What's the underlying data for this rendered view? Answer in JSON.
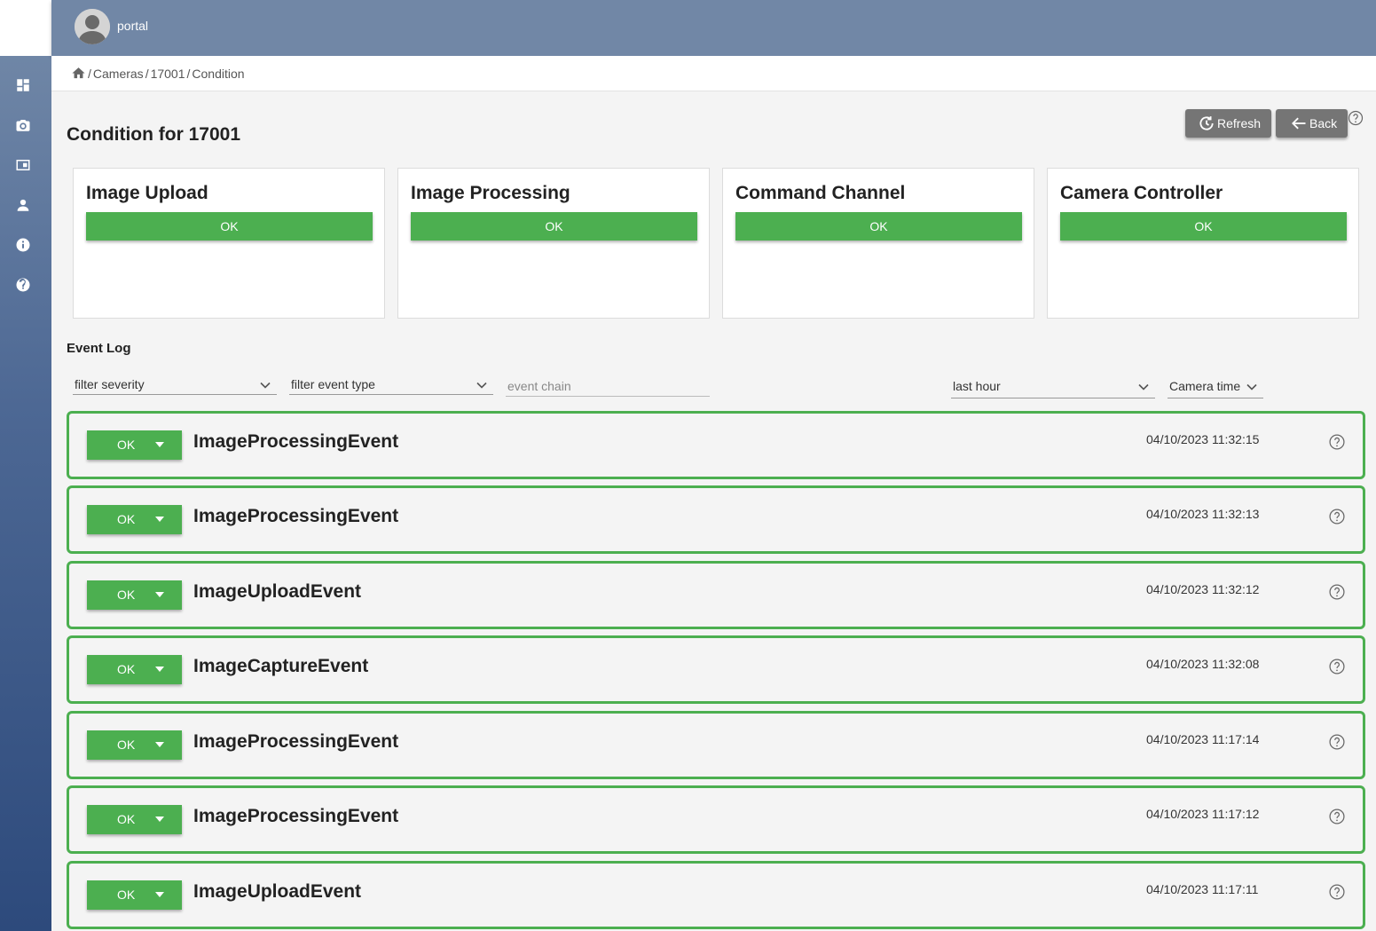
{
  "header": {
    "app_label": "portal"
  },
  "sidebar": {
    "items": [
      {
        "icon": "dashboard-icon"
      },
      {
        "icon": "camera-icon"
      },
      {
        "icon": "monitor-icon"
      },
      {
        "icon": "person-icon"
      },
      {
        "icon": "info-icon"
      },
      {
        "icon": "help-icon"
      }
    ]
  },
  "breadcrumb": {
    "sep": "/",
    "items": [
      "Cameras",
      "17001",
      "Condition"
    ]
  },
  "page": {
    "title": "Condition for 17001"
  },
  "toolbar": {
    "refresh_label": "Refresh",
    "back_label": "Back"
  },
  "cards": [
    {
      "title": "Image Upload",
      "status": "OK"
    },
    {
      "title": "Image Processing",
      "status": "OK"
    },
    {
      "title": "Command Channel",
      "status": "OK"
    },
    {
      "title": "Camera Controller",
      "status": "OK"
    }
  ],
  "event_log": {
    "title": "Event Log",
    "filters": {
      "severity": "filter severity",
      "event_type": "filter event type",
      "event_chain_placeholder": "event chain",
      "range": "last hour",
      "time_mode": "Camera time"
    },
    "events": [
      {
        "status": "OK",
        "name": "ImageProcessingEvent",
        "time": "04/10/2023 11:32:15"
      },
      {
        "status": "OK",
        "name": "ImageProcessingEvent",
        "time": "04/10/2023 11:32:13"
      },
      {
        "status": "OK",
        "name": "ImageUploadEvent",
        "time": "04/10/2023 11:32:12"
      },
      {
        "status": "OK",
        "name": "ImageCaptureEvent",
        "time": "04/10/2023 11:32:08"
      },
      {
        "status": "OK",
        "name": "ImageProcessingEvent",
        "time": "04/10/2023 11:17:14"
      },
      {
        "status": "OK",
        "name": "ImageProcessingEvent",
        "time": "04/10/2023 11:17:12"
      },
      {
        "status": "OK",
        "name": "ImageUploadEvent",
        "time": "04/10/2023 11:17:11"
      }
    ]
  },
  "colors": {
    "ok": "#4caf50",
    "topbar": "#7187a6",
    "button": "#757575"
  }
}
